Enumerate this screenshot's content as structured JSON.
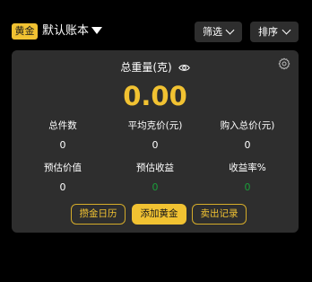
{
  "header": {
    "gold_tag": "黄金",
    "account_name": "默认账本",
    "filter_label": "筛选",
    "sort_label": "排序"
  },
  "summary": {
    "title": "总重量(克)",
    "total_weight": "0.00",
    "stats": [
      {
        "label": "总件数",
        "value": "0"
      },
      {
        "label": "平均克价(元)",
        "value": "0"
      },
      {
        "label": "购入总价(元)",
        "value": "0"
      },
      {
        "label": "预估价值",
        "value": "0"
      },
      {
        "label": "预估收益",
        "value": "0"
      },
      {
        "label": "收益率%",
        "value": "0"
      }
    ]
  },
  "actions": {
    "calendar": "攒金日历",
    "add_gold": "添加黄金",
    "sale_record": "卖出记录"
  },
  "colors": {
    "accent": "#f1c232",
    "card_bg": "#2e2e2e",
    "positive": "#1a9e3a"
  }
}
